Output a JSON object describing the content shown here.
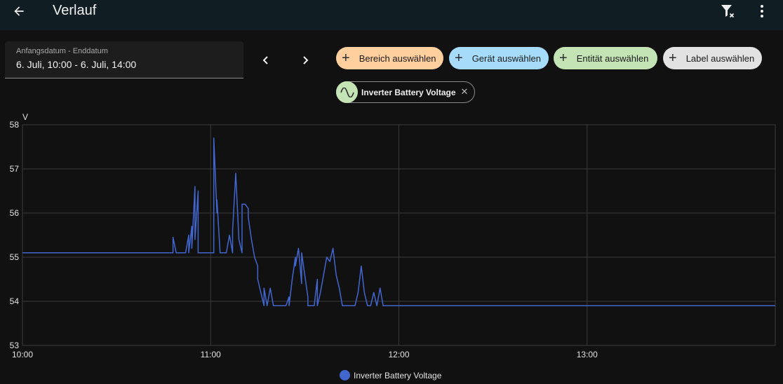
{
  "header": {
    "title": "Verlauf"
  },
  "date_range": {
    "label": "Anfangsdatum - Enddatum",
    "value": "6. Juli, 10:00 - 6. Juli, 14:00"
  },
  "target_chips": [
    {
      "label": "Bereich auswählen",
      "color": "#ffcf9e"
    },
    {
      "label": "Gerät auswählen",
      "color": "#a6dcf9"
    },
    {
      "label": "Entität auswählen",
      "color": "#c4e4b5"
    },
    {
      "label": "Label auswählen",
      "color": "#e2e2e2"
    }
  ],
  "selected_entity": {
    "name": "Inverter Battery Voltage",
    "icon": "sine-wave-icon"
  },
  "chart_data": {
    "type": "line",
    "yunit": "V",
    "ylim": [
      53,
      58
    ],
    "yticks": [
      "58",
      "57",
      "56",
      "55",
      "54",
      "53"
    ],
    "xlim": [
      "10:00",
      "14:00"
    ],
    "xticks": [
      "10:00",
      "11:00",
      "12:00",
      "13:00"
    ],
    "grid": true,
    "legend_position": "bottom",
    "series": [
      {
        "name": "Inverter Battery Voltage",
        "color": "#4266d0",
        "x": [
          "10:00",
          "10:30",
          "10:45",
          "10:48",
          "10:48",
          "10:49",
          "10:52",
          "10:53",
          "10:53",
          "10:54",
          "10:54",
          "10:55",
          "10:55",
          "10:56",
          "10:56",
          "10:57",
          "10:57",
          "10:58",
          "10:59",
          "11:00",
          "11:01",
          "11:01",
          "11:02",
          "11:02",
          "11:03",
          "11:04",
          "11:05",
          "11:06",
          "11:07",
          "11:07",
          "11:08",
          "11:09",
          "11:10",
          "11:10",
          "11:11",
          "11:12",
          "11:12",
          "11:13",
          "11:14",
          "11:15",
          "11:15",
          "11:16",
          "11:17",
          "11:17",
          "11:18",
          "11:19",
          "11:20",
          "11:22",
          "11:24",
          "11:25",
          "11:25",
          "11:26",
          "11:27",
          "11:27",
          "11:28",
          "11:29",
          "11:29",
          "11:31",
          "11:31",
          "11:33",
          "11:34",
          "11:34",
          "11:35",
          "11:36",
          "11:37",
          "11:38",
          "11:39",
          "11:40",
          "11:41",
          "11:42",
          "11:43",
          "11:44",
          "11:45",
          "11:46",
          "11:47",
          "11:48",
          "11:49",
          "11:50",
          "11:51",
          "11:52",
          "11:53",
          "11:54",
          "11:55",
          "11:56",
          "11:57",
          "11:58",
          "11:59",
          "12:00",
          "12:30",
          "13:00",
          "13:30",
          "14:00"
        ],
        "y": [
          55.1,
          55.1,
          55.1,
          55.1,
          55.45,
          55.1,
          55.1,
          55.5,
          55.1,
          55.7,
          55.2,
          56.6,
          55.4,
          56.5,
          55.1,
          55.1,
          55.1,
          55.1,
          55.1,
          55.1,
          55.1,
          57.7,
          56.0,
          56.3,
          55.1,
          55.1,
          55.1,
          55.5,
          55.1,
          55.6,
          56.9,
          55.4,
          55.1,
          56.2,
          56.2,
          56.1,
          55.9,
          55.4,
          55.0,
          54.8,
          54.5,
          54.2,
          53.9,
          54.3,
          53.9,
          54.3,
          53.9,
          53.9,
          53.9,
          54.1,
          53.9,
          54.5,
          55.0,
          54.8,
          55.2,
          54.4,
          55.1,
          54.1,
          53.9,
          53.9,
          54.5,
          53.9,
          54.2,
          54.6,
          55.0,
          54.9,
          55.2,
          54.6,
          54.3,
          53.9,
          53.9,
          53.9,
          53.9,
          53.9,
          54.2,
          54.8,
          54.2,
          53.9,
          53.9,
          54.2,
          53.9,
          54.3,
          53.9,
          53.9,
          53.9,
          53.9,
          53.9,
          53.9,
          53.9,
          53.9,
          53.9,
          53.9
        ]
      }
    ]
  }
}
